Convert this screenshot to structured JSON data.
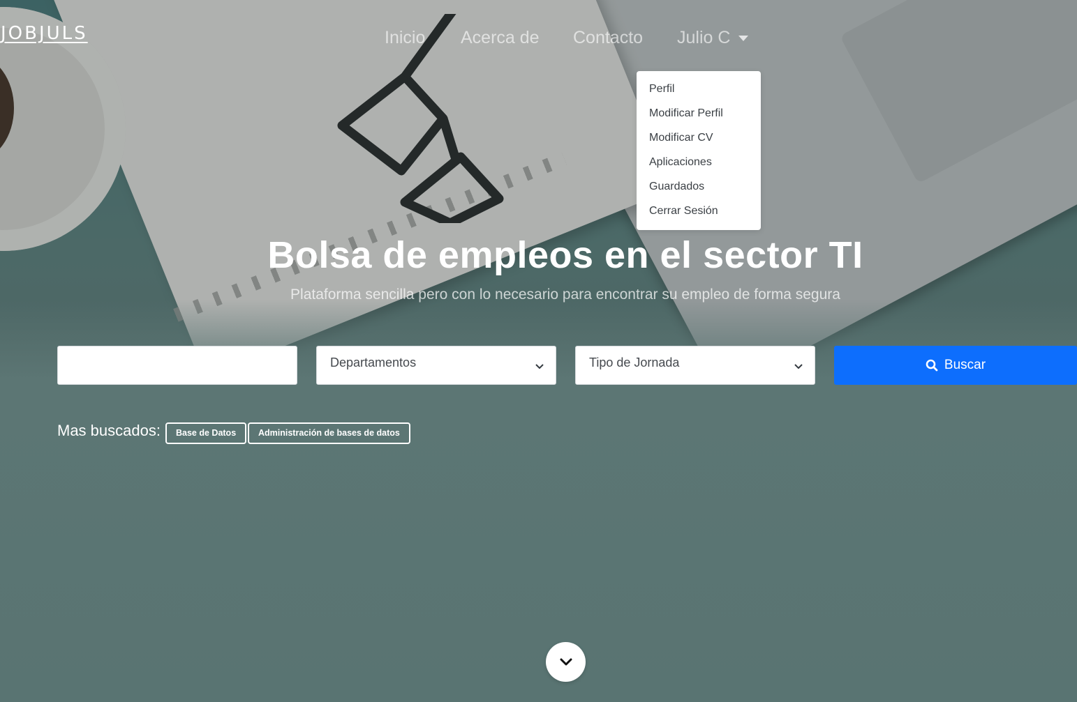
{
  "brand": "JOBJULS",
  "nav": {
    "links": [
      "Inicio",
      "Acerca de",
      "Contacto"
    ],
    "user": "Julio C"
  },
  "dropdown": {
    "items": [
      "Perfil",
      "Modificar Perfil",
      "Modificar CV",
      "Aplicaciones",
      "Guardados",
      "Cerrar Sesión"
    ]
  },
  "hero": {
    "title": "Bolsa de empleos en el sector TI",
    "subtitle": "Plataforma sencilla pero con lo necesario para encontrar su empleo de forma segura"
  },
  "search": {
    "keyword_value": "",
    "department_selected": "Departamentos",
    "jornada_selected": "Tipo de Jornada",
    "button_label": "Buscar"
  },
  "popular": {
    "label": "Mas buscados:",
    "tags": [
      "Base de Datos",
      "Administración de bases de datos"
    ]
  },
  "colors": {
    "accent": "#0d6efd",
    "background": "#5b7573"
  },
  "icons": [
    "search-icon",
    "chevron-down-icon",
    "caret-down-icon"
  ]
}
